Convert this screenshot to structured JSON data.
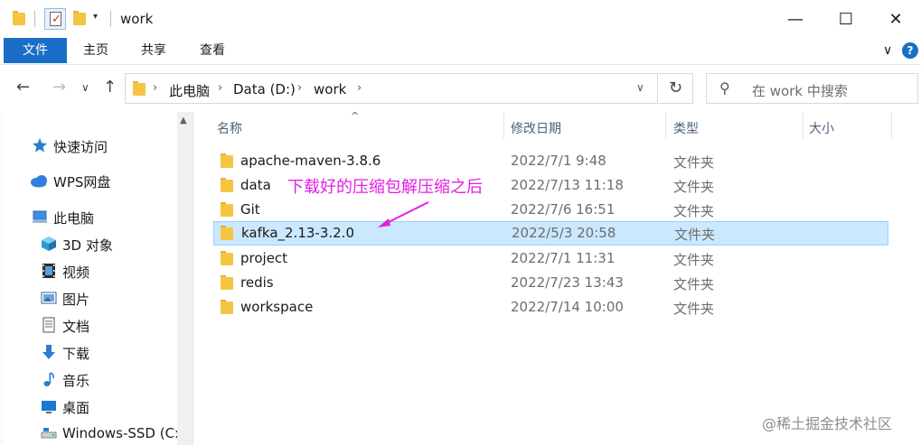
{
  "window": {
    "title": "work",
    "minimize_glyph": "—",
    "maximize_glyph": "☐",
    "close_glyph": "✕"
  },
  "quick_access_toolbar": {
    "dropdown_glyph": "▾"
  },
  "ribbon": {
    "tabs": [
      {
        "label": "文件",
        "active": true
      },
      {
        "label": "主页"
      },
      {
        "label": "共享"
      },
      {
        "label": "查看"
      }
    ],
    "expand_glyph": "∨",
    "help_glyph": "?"
  },
  "address_bar": {
    "back_glyph": "←",
    "forward_glyph": "→",
    "recent_glyph": "∨",
    "up_glyph": "↑",
    "crumbs": [
      "此电脑",
      "Data (D:)",
      "work"
    ],
    "separator_glyph": "›",
    "dropdown_glyph": "∨",
    "refresh_glyph": "↻"
  },
  "search": {
    "placeholder": "在 work 中搜索",
    "icon_glyph": "⚲"
  },
  "nav_pane": {
    "items": [
      {
        "label": "快速访问",
        "icon": "star-icon"
      },
      {
        "label": "WPS网盘",
        "icon": "cloud-icon"
      },
      {
        "label": "此电脑",
        "icon": "computer-icon"
      },
      {
        "label": "3D 对象",
        "icon": "cube-icon"
      },
      {
        "label": "视频",
        "icon": "video-icon"
      },
      {
        "label": "图片",
        "icon": "picture-icon"
      },
      {
        "label": "文档",
        "icon": "document-icon"
      },
      {
        "label": "下载",
        "icon": "download-icon"
      },
      {
        "label": "音乐",
        "icon": "music-icon"
      },
      {
        "label": "桌面",
        "icon": "desktop-icon"
      },
      {
        "label": "Windows-SSD (C:",
        "icon": "drive-icon"
      }
    ],
    "scroll_up_glyph": "▲"
  },
  "file_list": {
    "columns": {
      "name": "名称",
      "modified": "修改日期",
      "type": "类型",
      "size": "大小"
    },
    "sort_glyph": "^",
    "rows": [
      {
        "name": "apache-maven-3.8.6",
        "modified": "2022/7/1 9:48",
        "type": "文件夹",
        "selected": false
      },
      {
        "name": "data",
        "modified": "2022/7/13 11:18",
        "type": "文件夹",
        "selected": false
      },
      {
        "name": "Git",
        "modified": "2022/7/6 16:51",
        "type": "文件夹",
        "selected": false
      },
      {
        "name": "kafka_2.13-3.2.0",
        "modified": "2022/5/3 20:58",
        "type": "文件夹",
        "selected": true
      },
      {
        "name": "project",
        "modified": "2022/7/1 11:31",
        "type": "文件夹",
        "selected": false
      },
      {
        "name": "redis",
        "modified": "2022/7/23 13:43",
        "type": "文件夹",
        "selected": false
      },
      {
        "name": "workspace",
        "modified": "2022/7/14 10:00",
        "type": "文件夹",
        "selected": false
      }
    ]
  },
  "annotation": {
    "text": "下载好的压缩包解压缩之后",
    "color": "#e21fe2"
  },
  "watermark": "@稀土掘金技术社区",
  "colors": {
    "accent": "#1a6ec7",
    "selection_bg": "#cce8ff",
    "folder": "#f5c542"
  }
}
